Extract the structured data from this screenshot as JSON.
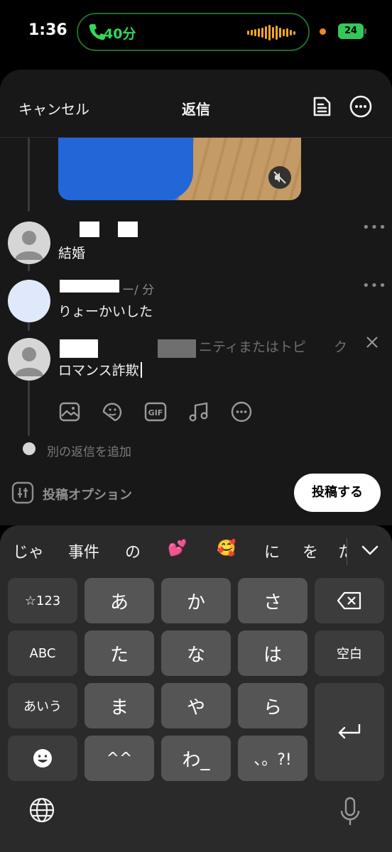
{
  "status_bar": {
    "time": "1:36",
    "call_duration": "40分",
    "battery": "24",
    "call_color": "#33d65a",
    "battery_color": "#34c759",
    "icons": [
      "phone-icon",
      "audio-wave-icon",
      "orange-privacy-dot",
      "battery-charging-icon"
    ]
  },
  "header": {
    "cancel_label": "キャンセル",
    "title": "返信",
    "icons": [
      "drafts-icon",
      "more-icon"
    ]
  },
  "thread": {
    "media": {
      "icon": "muted-speaker-icon"
    },
    "posts": [
      {
        "text": "結婚",
        "more": "•••"
      },
      {
        "name_fragment": "ー/ 分",
        "text": "りょーかいした",
        "more": "•••"
      }
    ],
    "reply": {
      "topic_placeholder": "ニティまたはトピ",
      "topic_tail": "ク",
      "text": "ロマンス詐欺"
    },
    "attach_icons": [
      "image-icon",
      "sticker-icon",
      "gif-icon",
      "music-icon",
      "more-circle-icon"
    ],
    "gif_label": "GIF",
    "add_reply": "別の返信を追加"
  },
  "footer": {
    "options_label": "投稿オプション",
    "post_button": "投稿する"
  },
  "keyboard": {
    "suggestions": [
      "じゃ",
      "事件",
      "の",
      "💕",
      "🥰",
      "に",
      "を",
      "た"
    ],
    "rows": [
      [
        "☆123",
        "あ",
        "か",
        "さ",
        "⌫"
      ],
      [
        "ABC",
        "た",
        "な",
        "は",
        "空白"
      ],
      [
        "あいう",
        "ま",
        "や",
        "ら",
        "⏎"
      ],
      [
        "☻",
        "^^",
        "わ_",
        "、。?!"
      ]
    ],
    "bottom_icons": [
      "globe-icon",
      "microphone-icon"
    ]
  }
}
